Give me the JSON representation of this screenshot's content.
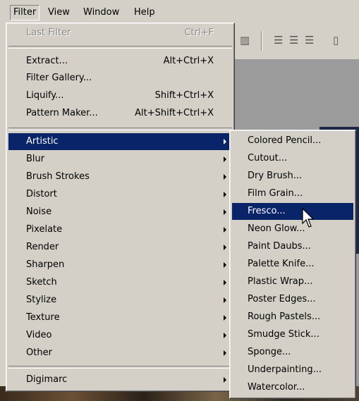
{
  "menubar": {
    "items": [
      {
        "label": "Filter"
      },
      {
        "label": "View"
      },
      {
        "label": "Window"
      },
      {
        "label": "Help"
      }
    ]
  },
  "filter_menu": {
    "last_filter": {
      "label": "Last Filter",
      "shortcut": "Ctrl+F"
    },
    "extract": {
      "label": "Extract...",
      "shortcut": "Alt+Ctrl+X"
    },
    "filter_gallery": {
      "label": "Filter Gallery..."
    },
    "liquify": {
      "label": "Liquify...",
      "shortcut": "Shift+Ctrl+X"
    },
    "pattern_maker": {
      "label": "Pattern Maker...",
      "shortcut": "Alt+Shift+Ctrl+X"
    },
    "groups": [
      {
        "label": "Artistic"
      },
      {
        "label": "Blur"
      },
      {
        "label": "Brush Strokes"
      },
      {
        "label": "Distort"
      },
      {
        "label": "Noise"
      },
      {
        "label": "Pixelate"
      },
      {
        "label": "Render"
      },
      {
        "label": "Sharpen"
      },
      {
        "label": "Sketch"
      },
      {
        "label": "Stylize"
      },
      {
        "label": "Texture"
      },
      {
        "label": "Video"
      },
      {
        "label": "Other"
      }
    ],
    "digimarc": {
      "label": "Digimarc"
    }
  },
  "artistic_submenu": {
    "items": [
      {
        "label": "Colored Pencil..."
      },
      {
        "label": "Cutout..."
      },
      {
        "label": "Dry Brush..."
      },
      {
        "label": "Film Grain..."
      },
      {
        "label": "Fresco..."
      },
      {
        "label": "Neon Glow..."
      },
      {
        "label": "Paint Daubs..."
      },
      {
        "label": "Palette Knife..."
      },
      {
        "label": "Plastic Wrap..."
      },
      {
        "label": "Poster Edges..."
      },
      {
        "label": "Rough Pastels..."
      },
      {
        "label": "Smudge Stick..."
      },
      {
        "label": "Sponge..."
      },
      {
        "label": "Underpainting..."
      },
      {
        "label": "Watercolor..."
      }
    ]
  },
  "highlighted": {
    "menu_item": "Artistic",
    "submenu_item": "Fresco..."
  },
  "colors": {
    "highlight": "#0a246a",
    "menu_bg": "#d4d0c8",
    "disabled_text": "#8a8a8a"
  },
  "icons": [
    "submenu-arrow-icon",
    "mouse-pointer-icon",
    "align-tool-icon"
  ]
}
